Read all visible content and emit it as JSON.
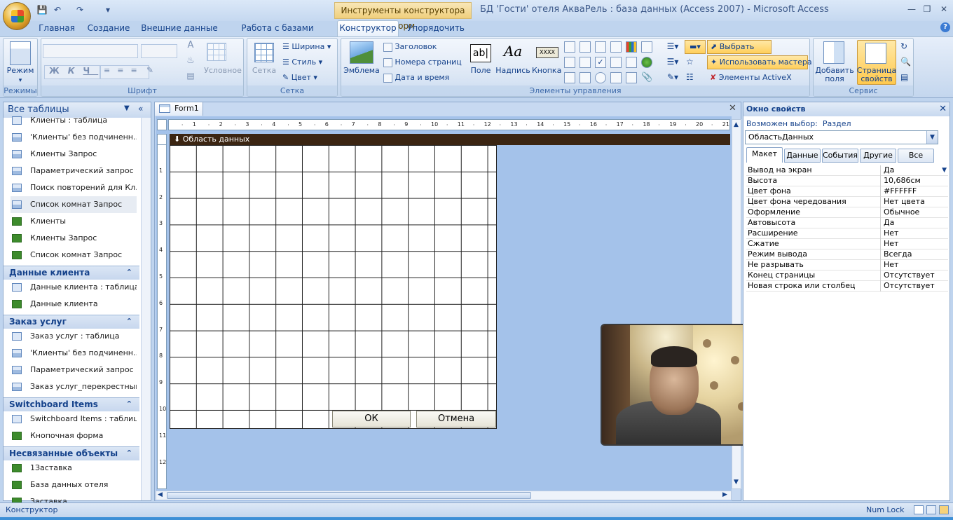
{
  "window": {
    "context_tab_title": "Инструменты конструктора форм",
    "title": "БД 'Гости' отеля АкваРель : база данных (Access 2007) - Microsoft Access"
  },
  "ribbon_tabs": [
    "Главная",
    "Создание",
    "Внешние данные",
    "Работа с базами данных",
    "Конструктор",
    "Упорядочить"
  ],
  "ribbon": {
    "views": {
      "mode_label": "Режим",
      "group_label": "Режимы"
    },
    "font": {
      "conditional_label": "Условное",
      "group_label": "Шрифт"
    },
    "grid": {
      "grid_label": "Сетка",
      "width_label": "Ширина",
      "style_label": "Стиль",
      "color_label": "Цвет",
      "group_label": "Сетка"
    },
    "controls": {
      "logo_label": "Эмблема",
      "title_label": "Заголовок",
      "page_numbers_label": "Номера страниц",
      "datetime_label": "Дата и время",
      "field_label": "Поле",
      "label_label": "Надпись",
      "button_label": "Кнопка",
      "button_icon_text": "XXXX",
      "textbox_icon_text": "ab|",
      "label_icon_text": "Aa",
      "select_label": "Выбрать",
      "wizard_label": "Использовать мастера",
      "activex_label": "Элементы ActiveX",
      "group_label": "Элементы управления"
    },
    "tools": {
      "add_fields_label": "Добавить поля",
      "property_sheet_label": "Страница свойств",
      "group_label": "Сервис"
    }
  },
  "nav": {
    "header": "Все таблицы",
    "top_items": [
      {
        "label": "Клиенты : таблица",
        "icon": "table-icon"
      },
      {
        "label": "'Клиенты' без подчиненн...",
        "icon": "query-icon"
      },
      {
        "label": "Клиенты Запрос",
        "icon": "query-icon"
      },
      {
        "label": "Параметрический запрос",
        "icon": "query-icon"
      },
      {
        "label": "Поиск повторений для Кл...",
        "icon": "query-icon"
      },
      {
        "label": "Список комнат Запрос",
        "icon": "query-icon"
      },
      {
        "label": "Клиенты",
        "icon": "form-icon"
      },
      {
        "label": "Клиенты Запрос",
        "icon": "form-icon"
      },
      {
        "label": "Список комнат Запрос",
        "icon": "form-icon"
      }
    ],
    "groups": [
      {
        "title": "Данные клиента",
        "items": [
          {
            "label": "Данные клиента : таблица",
            "icon": "table-icon"
          },
          {
            "label": "Данные клиента",
            "icon": "form-icon"
          }
        ]
      },
      {
        "title": "Заказ услуг",
        "items": [
          {
            "label": "Заказ услуг : таблица",
            "icon": "table-icon"
          },
          {
            "label": "'Клиенты' без подчиненн...",
            "icon": "query-icon"
          },
          {
            "label": "Параметрический запрос",
            "icon": "query-icon"
          },
          {
            "label": "Заказ услуг_перекрестный",
            "icon": "query-icon"
          }
        ]
      },
      {
        "title": "Switchboard Items",
        "items": [
          {
            "label": "Switchboard Items : таблица",
            "icon": "table-icon"
          },
          {
            "label": "Кнопочная форма",
            "icon": "form-icon"
          }
        ]
      },
      {
        "title": "Несвязанные объекты",
        "items": [
          {
            "label": "1Заставка",
            "icon": "form-icon"
          },
          {
            "label": "База данных отеля",
            "icon": "form-icon"
          },
          {
            "label": "Заставка",
            "icon": "form-icon"
          }
        ]
      }
    ]
  },
  "document": {
    "tab_label": "Form1",
    "section_label": "Область данных",
    "ok_button": "ОК",
    "cancel_button": "Отмена",
    "ruler_marks": [
      "1",
      "2",
      "3",
      "4",
      "5",
      "6",
      "7",
      "8",
      "9",
      "10",
      "11",
      "12",
      "13",
      "14",
      "15",
      "16",
      "17",
      "18",
      "19",
      "20",
      "21"
    ],
    "vruler_marks": [
      "1",
      "2",
      "3",
      "4",
      "5",
      "6",
      "7",
      "8",
      "9",
      "10",
      "11",
      "12"
    ]
  },
  "properties": {
    "title": "Окно свойств",
    "selection_type_label": "Возможен выбор:",
    "selection_type": "Раздел",
    "selected_object": "ОбластьДанных",
    "tabs": [
      "Макет",
      "Данные",
      "События",
      "Другие",
      "Все"
    ],
    "rows": [
      {
        "name": "Вывод на экран",
        "value": "Да"
      },
      {
        "name": "Высота",
        "value": "10,686см"
      },
      {
        "name": "Цвет фона",
        "value": "#FFFFFF"
      },
      {
        "name": "Цвет фона чередования",
        "value": "Нет цвета"
      },
      {
        "name": "Оформление",
        "value": "Обычное"
      },
      {
        "name": "Автовысота",
        "value": "Да"
      },
      {
        "name": "Расширение",
        "value": "Нет"
      },
      {
        "name": "Сжатие",
        "value": "Нет"
      },
      {
        "name": "Режим вывода",
        "value": "Всегда"
      },
      {
        "name": "Не разрывать",
        "value": "Нет"
      },
      {
        "name": "Конец страницы",
        "value": "Отсутствует"
      },
      {
        "name": "Новая строка или столбец",
        "value": "Отсутствует"
      }
    ]
  },
  "status": {
    "left": "Конструктор",
    "numlock": "Num Lock"
  }
}
